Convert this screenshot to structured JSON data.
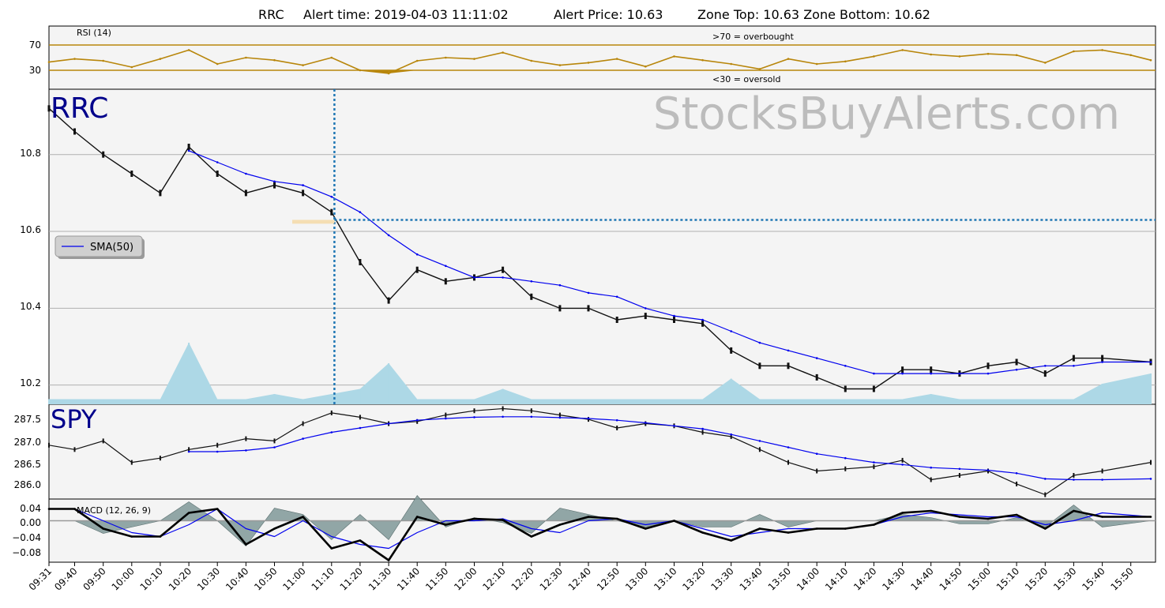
{
  "title": {
    "symbol": "RRC",
    "alert_time": "Alert time: 2019-04-03 11:11:02",
    "alert_price": "Alert Price: 10.63",
    "zone": "Zone Top: 10.63  Zone Bottom: 10.62"
  },
  "watermark": "StocksBuyAlerts.com",
  "colors": {
    "panel_bg": "#f4f4f4",
    "rsi": "#b8860b",
    "sma": "#0000ee",
    "volume": "#add8e6",
    "ticker": "#00008b",
    "alert_line": "#1f77b4",
    "macd_hist": "#7f9898",
    "macd_line": "#000000",
    "signal_line": "#0000ee"
  },
  "x_axis": {
    "labels": [
      "09:31",
      "09:40",
      "09:50",
      "10:00",
      "10:10",
      "10:20",
      "10:30",
      "10:40",
      "10:50",
      "11:00",
      "11:10",
      "11:20",
      "11:30",
      "11:40",
      "11:50",
      "12:00",
      "12:10",
      "12:20",
      "12:30",
      "12:40",
      "12:50",
      "13:00",
      "13:10",
      "13:20",
      "13:30",
      "13:40",
      "13:50",
      "14:00",
      "14:10",
      "14:20",
      "14:30",
      "14:40",
      "14:50",
      "15:00",
      "15:10",
      "15:20",
      "15:30",
      "15:40",
      "15:50"
    ]
  },
  "rsi_panel": {
    "label": "RSI (14)",
    "overbought_note": ">70 = overbought",
    "oversold_note": "<30 = oversold",
    "ticks": [
      "70",
      "30"
    ],
    "levels": [
      70,
      30
    ]
  },
  "price_panel": {
    "ticker": "RRC",
    "legend": "SMA(50)",
    "ticks": [
      "10.8",
      "10.6",
      "10.4",
      "10.2"
    ]
  },
  "spy_panel": {
    "ticker": "SPY",
    "ticks": [
      "287.5",
      "287.0",
      "286.5",
      "286.0"
    ]
  },
  "macd_panel": {
    "label": "MACD (12, 26, 9)",
    "ticks": [
      "0.04",
      "0.00",
      "−0.04",
      "−0.08"
    ]
  },
  "chart_data": [
    {
      "type": "line",
      "panel": "RSI (14)",
      "x": [
        "09:31",
        "09:40",
        "09:50",
        "10:00",
        "10:10",
        "10:20",
        "10:30",
        "10:40",
        "10:50",
        "11:00",
        "11:10",
        "11:20",
        "11:30",
        "11:40",
        "11:50",
        "12:00",
        "12:10",
        "12:20",
        "12:30",
        "12:40",
        "12:50",
        "13:00",
        "13:10",
        "13:20",
        "13:30",
        "13:40",
        "13:50",
        "14:00",
        "14:10",
        "14:20",
        "14:30",
        "14:40",
        "14:50",
        "15:00",
        "15:10",
        "15:20",
        "15:30",
        "15:40",
        "15:50",
        "15:57"
      ],
      "series": [
        {
          "values": [
            43,
            48,
            45,
            35,
            48,
            62,
            40,
            50,
            46,
            38,
            50,
            30,
            25,
            45,
            50,
            48,
            58,
            45,
            38,
            42,
            48,
            36,
            52,
            46,
            40,
            32,
            48,
            40,
            44,
            52,
            62,
            55,
            52,
            56,
            54,
            42,
            60,
            62,
            54,
            46
          ]
        }
      ],
      "ylim": [
        0,
        100
      ],
      "reference_lines": [
        70,
        30
      ]
    },
    {
      "type": "line",
      "panel": "RRC",
      "x": [
        "09:31",
        "09:40",
        "09:50",
        "10:00",
        "10:10",
        "10:20",
        "10:30",
        "10:40",
        "10:50",
        "11:00",
        "11:10",
        "11:20",
        "11:30",
        "11:40",
        "11:50",
        "12:00",
        "12:10",
        "12:20",
        "12:30",
        "12:40",
        "12:50",
        "13:00",
        "13:10",
        "13:20",
        "13:30",
        "13:40",
        "13:50",
        "14:00",
        "14:10",
        "14:20",
        "14:30",
        "14:40",
        "14:50",
        "15:00",
        "15:10",
        "15:20",
        "15:30",
        "15:40",
        "15:57"
      ],
      "series": [
        {
          "name": "RRC",
          "values": [
            10.92,
            10.86,
            10.8,
            10.75,
            10.7,
            10.82,
            10.75,
            10.7,
            10.72,
            10.7,
            10.65,
            10.52,
            10.42,
            10.5,
            10.47,
            10.48,
            10.5,
            10.43,
            10.4,
            10.4,
            10.37,
            10.38,
            10.37,
            10.36,
            10.29,
            10.25,
            10.25,
            10.22,
            10.19,
            10.19,
            10.24,
            10.24,
            10.23,
            10.25,
            10.26,
            10.23,
            10.27,
            10.27,
            10.26
          ]
        },
        {
          "name": "SMA(50)",
          "values": [
            null,
            null,
            null,
            null,
            null,
            10.81,
            10.78,
            10.75,
            10.73,
            10.72,
            10.69,
            10.65,
            10.59,
            10.54,
            10.51,
            10.48,
            10.48,
            10.47,
            10.46,
            10.44,
            10.43,
            10.4,
            10.38,
            10.37,
            10.34,
            10.31,
            10.29,
            10.27,
            10.25,
            10.23,
            10.23,
            10.23,
            10.23,
            10.23,
            10.24,
            10.25,
            10.25,
            10.26,
            10.26
          ]
        }
      ],
      "ylim": [
        10.15,
        10.97
      ],
      "alert": {
        "time": "11:11",
        "price": 10.63,
        "zone_top": 10.63,
        "zone_bottom": 10.62
      },
      "volume": [
        1,
        1,
        1,
        1,
        1,
        12,
        1,
        1,
        2,
        1,
        2,
        3,
        8,
        1,
        1,
        1,
        3,
        1,
        1,
        1,
        1,
        1,
        1,
        1,
        5,
        1,
        1,
        1,
        1,
        1,
        1,
        2,
        1,
        1,
        1,
        1,
        1,
        4,
        6
      ]
    },
    {
      "type": "line",
      "panel": "SPY",
      "x": [
        "09:31",
        "09:40",
        "09:50",
        "10:00",
        "10:10",
        "10:20",
        "10:30",
        "10:40",
        "10:50",
        "11:00",
        "11:10",
        "11:20",
        "11:30",
        "11:40",
        "11:50",
        "12:00",
        "12:10",
        "12:20",
        "12:30",
        "12:40",
        "12:50",
        "13:00",
        "13:10",
        "13:20",
        "13:30",
        "13:40",
        "13:50",
        "14:00",
        "14:10",
        "14:20",
        "14:30",
        "14:40",
        "14:50",
        "15:00",
        "15:10",
        "15:20",
        "15:30",
        "15:40",
        "15:57"
      ],
      "series": [
        {
          "name": "SPY",
          "values": [
            287.0,
            286.9,
            287.1,
            286.6,
            286.7,
            286.9,
            287.0,
            287.15,
            287.1,
            287.5,
            287.75,
            287.65,
            287.5,
            287.55,
            287.7,
            287.8,
            287.85,
            287.8,
            287.7,
            287.6,
            287.4,
            287.5,
            287.45,
            287.3,
            287.2,
            286.9,
            286.6,
            286.4,
            286.45,
            286.5,
            286.65,
            286.2,
            286.3,
            286.4,
            286.1,
            285.85,
            286.3,
            286.4,
            286.6
          ]
        },
        {
          "name": "SMA(50)",
          "values": [
            null,
            null,
            null,
            null,
            null,
            286.85,
            286.85,
            286.88,
            286.95,
            287.15,
            287.3,
            287.4,
            287.5,
            287.58,
            287.62,
            287.65,
            287.66,
            287.66,
            287.64,
            287.62,
            287.58,
            287.52,
            287.45,
            287.38,
            287.25,
            287.1,
            286.95,
            286.8,
            286.7,
            286.6,
            286.55,
            286.48,
            286.45,
            286.42,
            286.35,
            286.22,
            286.2,
            286.2,
            286.22
          ]
        }
      ],
      "ylim": [
        285.75,
        287.95
      ]
    },
    {
      "type": "line",
      "panel": "MACD (12, 26, 9)",
      "x": [
        "09:31",
        "09:40",
        "09:50",
        "10:00",
        "10:10",
        "10:20",
        "10:30",
        "10:40",
        "10:50",
        "11:00",
        "11:10",
        "11:20",
        "11:30",
        "11:40",
        "11:50",
        "12:00",
        "12:10",
        "12:20",
        "12:30",
        "12:40",
        "12:50",
        "13:00",
        "13:10",
        "13:20",
        "13:30",
        "13:40",
        "13:50",
        "14:00",
        "14:10",
        "14:20",
        "14:30",
        "14:40",
        "14:50",
        "15:00",
        "15:10",
        "15:20",
        "15:30",
        "15:40",
        "15:57"
      ],
      "series": [
        {
          "name": "MACD",
          "values": [
            0.03,
            0.03,
            -0.02,
            -0.04,
            -0.04,
            0.02,
            0.03,
            -0.06,
            -0.02,
            0.01,
            -0.07,
            -0.05,
            -0.1,
            0.01,
            -0.01,
            0.005,
            0.002,
            -0.04,
            -0.01,
            0.01,
            0.005,
            -0.02,
            0.0,
            -0.03,
            -0.05,
            -0.02,
            -0.03,
            -0.02,
            -0.02,
            -0.01,
            0.02,
            0.025,
            0.01,
            0.005,
            0.015,
            -0.02,
            0.025,
            0.01,
            0.01
          ]
        },
        {
          "name": "Signal",
          "values": [
            0.03,
            0.03,
            0.0,
            -0.03,
            -0.04,
            -0.01,
            0.03,
            -0.02,
            -0.04,
            0.0,
            -0.04,
            -0.06,
            -0.07,
            -0.03,
            0.0,
            0.0,
            0.005,
            -0.02,
            -0.03,
            0.0,
            0.005,
            -0.01,
            0.0,
            -0.02,
            -0.04,
            -0.03,
            -0.02,
            -0.02,
            -0.02,
            -0.01,
            0.01,
            0.02,
            0.015,
            0.01,
            0.01,
            -0.01,
            0.0,
            0.02,
            0.01
          ]
        }
      ],
      "ylim": [
        -0.105,
        0.055
      ]
    }
  ]
}
